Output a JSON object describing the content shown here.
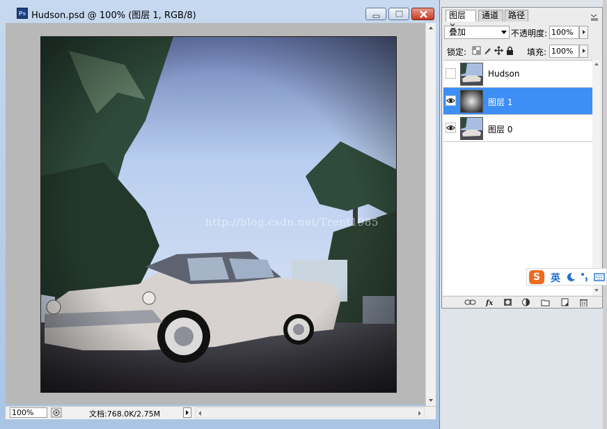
{
  "document_window": {
    "app_icon_text": "Ps",
    "title": "Hudson.psd @ 100% (图层 1, RGB/8)",
    "status": {
      "zoom": "100%",
      "doc_info": "文档:768.0K/2.75M"
    }
  },
  "watermark": "http://blog.csdn.net/Trent1985",
  "layers_panel": {
    "tabs": [
      {
        "label": "图层",
        "close": "×"
      },
      {
        "label": "通道"
      },
      {
        "label": "路径"
      }
    ],
    "blend_mode": "叠加",
    "opacity_label": "不透明度:",
    "opacity_value": "100%",
    "lock_label": "锁定:",
    "fill_label": "填充:",
    "fill_value": "100%",
    "layers": [
      {
        "name": "Hudson",
        "visible": false,
        "selected": false,
        "thumb": "photo"
      },
      {
        "name": "图层 1",
        "visible": true,
        "selected": true,
        "thumb": "vignette"
      },
      {
        "name": "图层 0",
        "visible": true,
        "selected": false,
        "thumb": "photo"
      }
    ],
    "footer_icons": [
      "link-icon",
      "fx-icon",
      "mask-icon",
      "adjustment-icon",
      "folder-icon",
      "new-layer-icon",
      "trash-icon"
    ]
  },
  "ime_bar": {
    "logo": "S",
    "lang": "英"
  },
  "colors": {
    "selected_row": "#3d8ef5",
    "ime_logo": "#ee6a1c"
  }
}
